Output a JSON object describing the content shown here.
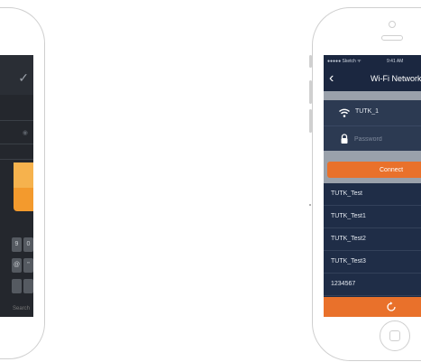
{
  "left_phone": {
    "keys_row1": [
      "9",
      "0"
    ],
    "keys_row2": [
      "@",
      "\""
    ],
    "search_label": "Search"
  },
  "right_phone": {
    "status": {
      "carrier": "●●●●● Sketch ᯤ",
      "time": "9:41 AM"
    },
    "nav": {
      "title": "Wi-Fi Network"
    },
    "form": {
      "ssid": "TUTK_1",
      "password_placeholder": "Password"
    },
    "connect_label": "Connect",
    "networks": [
      {
        "name": "TUTK_Test"
      },
      {
        "name": "TUTK_Test1"
      },
      {
        "name": "TUTK_Test2"
      },
      {
        "name": "TUTK_Test3"
      },
      {
        "name": "1234567"
      }
    ],
    "colors": {
      "accent": "#e9712b",
      "background": "#1f2d47"
    },
    "icons": [
      "back-chevron-icon",
      "wifi-icon",
      "lock-icon",
      "refresh-icon"
    ]
  }
}
